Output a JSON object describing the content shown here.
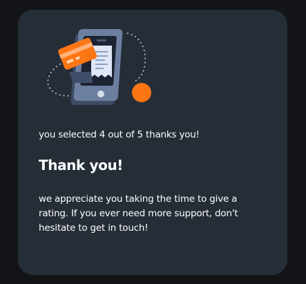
{
  "thank_you_card": {
    "illustration_icon": "card-payment-phone-illustration",
    "selection_text": "you selected 4 out of 5 thanks you!",
    "title": "Thank you!",
    "message": "we appreciate you taking the time to give a rating. If you ever need more support, don't hesitate to get in touch!"
  },
  "colors": {
    "page_background": "#121417",
    "card_background": "#252d37",
    "accent_orange": "#fc7614",
    "text": "#ffffff"
  }
}
